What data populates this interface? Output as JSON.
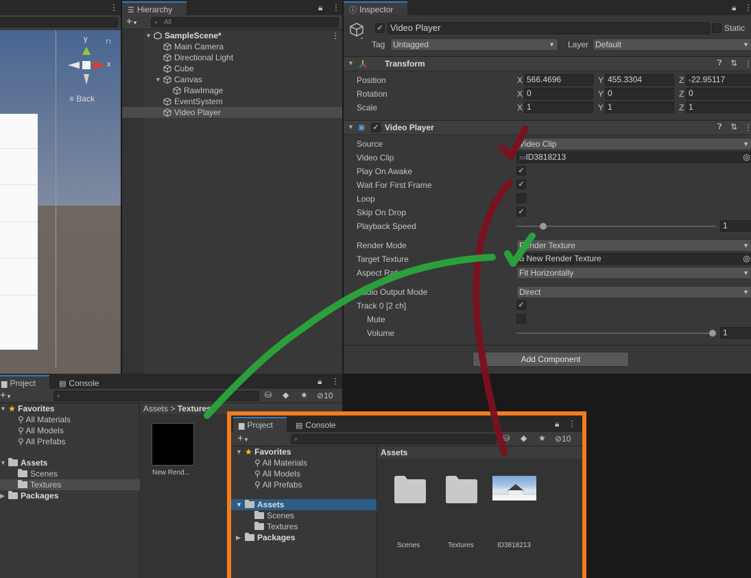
{
  "colors": {
    "accent": "#3a79bb",
    "highlight_frame": "#f47c20",
    "annotation_green": "#2aa43c",
    "annotation_red": "#7a1020"
  },
  "scene": {
    "gizmo_y": "y",
    "gizmo_x": "x",
    "view_label": "Back"
  },
  "hierarchy": {
    "tab": "Hierarchy",
    "search_placeholder": "All",
    "scene_name": "SampleScene*",
    "items": [
      {
        "label": "Main Camera"
      },
      {
        "label": "Directional Light"
      },
      {
        "label": "Cube"
      },
      {
        "label": "Canvas"
      },
      {
        "label": "RawImage"
      },
      {
        "label": "EventSystem"
      },
      {
        "label": "Video Player"
      }
    ]
  },
  "inspector": {
    "tab": "Inspector",
    "object_name": "Video Player",
    "static_label": "Static",
    "tag_label": "Tag",
    "tag_value": "Untagged",
    "layer_label": "Layer",
    "layer_value": "Default",
    "transform": {
      "title": "Transform",
      "position_label": "Position",
      "rotation_label": "Rotation",
      "scale_label": "Scale",
      "x": "X",
      "y": "Y",
      "z": "Z",
      "position": [
        "566.4696",
        "455.3304",
        "-22.95117"
      ],
      "rotation": [
        "0",
        "0",
        "0"
      ],
      "scale": [
        "1",
        "1",
        "1"
      ]
    },
    "video_player": {
      "title": "Video Player",
      "source_label": "Source",
      "source_value": "Video Clip",
      "clip_label": "Video Clip",
      "clip_value": "ID3818213",
      "play_on_awake": "Play On Awake",
      "wait_first_frame": "Wait For First Frame",
      "loop": "Loop",
      "skip_on_drop": "Skip On Drop",
      "playback_speed": "Playback Speed",
      "playback_speed_value": "1",
      "playback_speed_level": 0.12,
      "render_mode_label": "Render Mode",
      "render_mode_value": "Render Texture",
      "target_texture_label": "Target Texture",
      "target_texture_value": "New Render Texture",
      "aspect_ratio_label": "Aspect Ratio",
      "aspect_ratio_value": "Fit Horizontally",
      "audio_output_label": "Audio Output Mode",
      "audio_output_value": "Direct",
      "track_label": "Track 0 [2 ch]",
      "mute_label": "Mute",
      "volume_label": "Volume",
      "volume_value": "1",
      "volume_level": 1.0
    },
    "add_component": "Add Component"
  },
  "project_left": {
    "tab_project": "Project",
    "tab_console": "Console",
    "hidden_count": "10",
    "favorites": "Favorites",
    "fav_items": [
      "All Materials",
      "All Models",
      "All Prefabs"
    ],
    "assets": "Assets",
    "asset_items": [
      "Scenes",
      "Textures"
    ],
    "packages": "Packages",
    "breadcrumb_root": "Assets",
    "breadcrumb_sep": ">",
    "breadcrumb_leaf": "Textures",
    "thumb_label": "New Rend..."
  },
  "project_right": {
    "tab_project": "Project",
    "tab_console": "Console",
    "hidden_count": "10",
    "favorites": "Favorites",
    "fav_items": [
      "All Materials",
      "All Models",
      "All Prefabs"
    ],
    "assets": "Assets",
    "asset_items": [
      "Scenes",
      "Textures"
    ],
    "packages": "Packages",
    "grid_title": "Assets",
    "grid_items": [
      "Scenes",
      "Textures",
      "ID3818213"
    ]
  }
}
